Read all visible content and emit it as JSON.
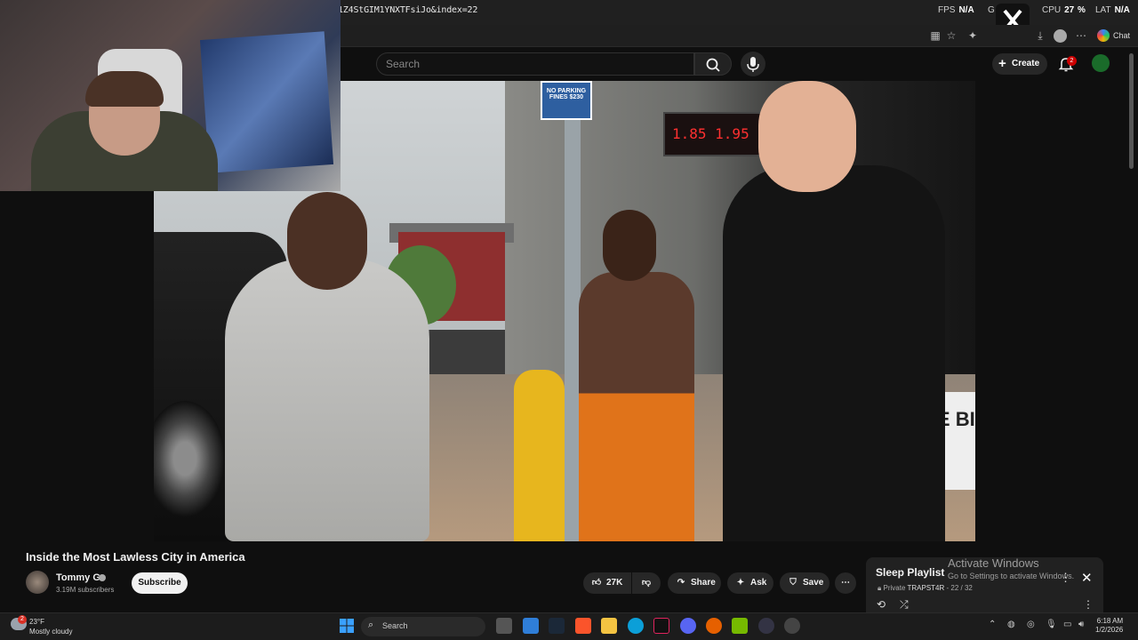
{
  "overlay": {
    "fps_label": "FPS",
    "fps_value": "N/A",
    "gpu_label": "G",
    "cpu_label": "CPU",
    "cpu_value": "27",
    "cpu_unit": "%",
    "lat_label": "LAT",
    "lat_value": "N/A"
  },
  "browser": {
    "url": "1Z4StGIM1YNXTFsiJo&index=22",
    "chat_label": "Chat"
  },
  "youtube": {
    "search_placeholder": "Search",
    "create_label": "Create",
    "notification_count": "2"
  },
  "video": {
    "led_text": "1.85 1.95",
    "sign_text": "NO PARKING FINES $230",
    "seven_text": "AVE BI",
    "title": "Inside the Most Lawless City in America",
    "channel_name": "Tommy G",
    "subscribers": "3.19M subscribers",
    "subscribe_label": "Subscribe",
    "likes": "27K",
    "share_label": "Share",
    "ask_label": "Ask",
    "save_label": "Save"
  },
  "playlist": {
    "title": "Sleep Playlist",
    "privacy": "Private",
    "owner": "TRAPST4R",
    "position": "22 / 32"
  },
  "windows_watermark": {
    "line1": "Activate Windows",
    "line2": "Go to Settings to activate Windows."
  },
  "taskbar": {
    "weather_temp": "23°F",
    "weather_desc": "Mostly cloudy",
    "weather_badge": "2",
    "search_label": "Search",
    "time": "6:18 AM",
    "date": "1/2/2026"
  },
  "colors": {
    "yt_red": "#cc0000",
    "bg": "#0f0f0f"
  }
}
